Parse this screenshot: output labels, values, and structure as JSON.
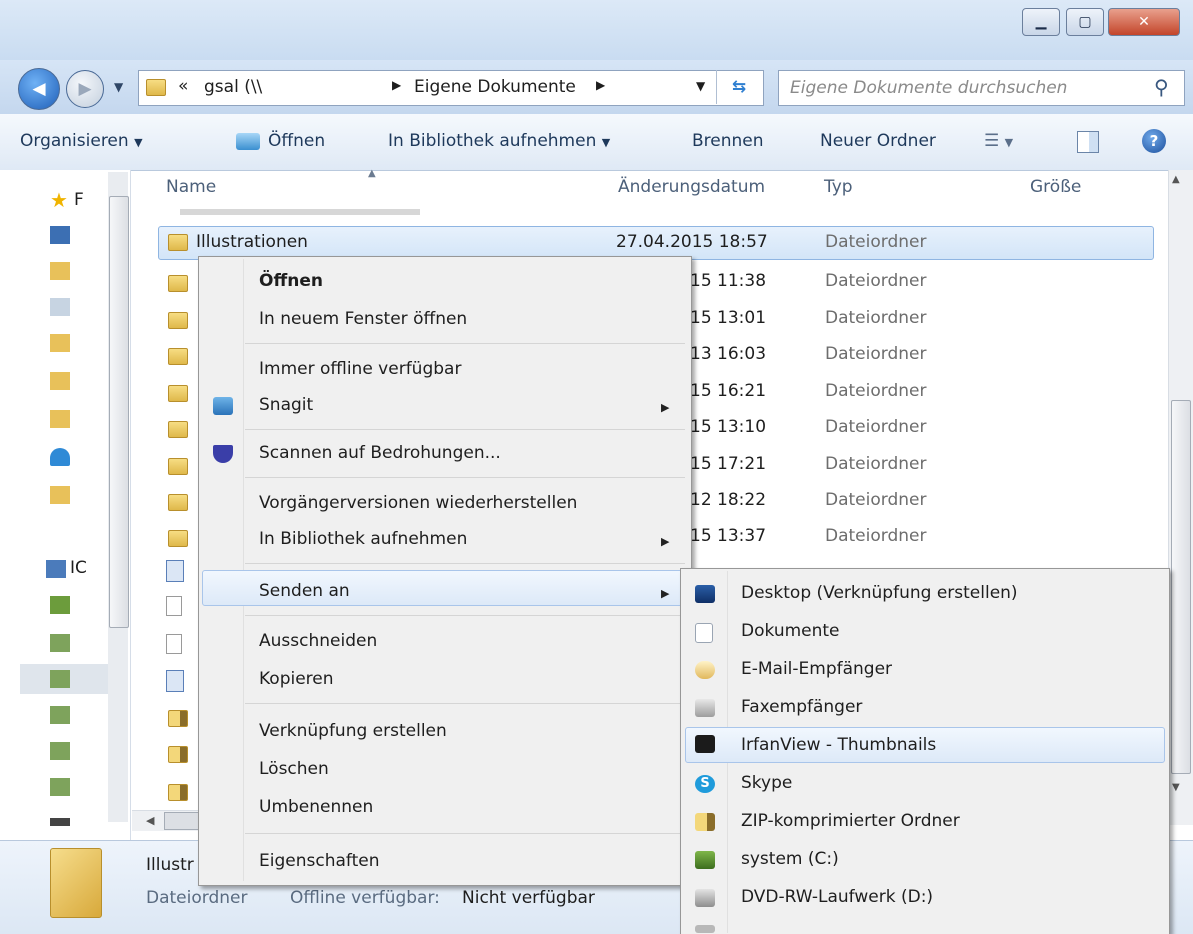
{
  "address": {
    "prefix": "«",
    "segment1": "gsal (\\\\",
    "segment2": "Eigene Dokumente",
    "search_placeholder": "Eigene Dokumente durchsuchen"
  },
  "toolbar": {
    "organize": "Organisieren",
    "open": "Öffnen",
    "add_library": "In Bibliothek aufnehmen",
    "burn": "Brennen",
    "new_folder": "Neuer Ordner"
  },
  "columns": {
    "name": "Name",
    "date": "Änderungsdatum",
    "type": "Typ",
    "size": "Größe"
  },
  "nav": {
    "favorites": "F",
    "computer": "IC"
  },
  "rows": [
    {
      "name": "Illustrationen",
      "date": "27.04.2015 18:57",
      "type": "Dateiordner"
    },
    {
      "date": "15 11:38",
      "type": "Dateiordner"
    },
    {
      "date": "15 13:01",
      "type": "Dateiordner"
    },
    {
      "date": "13 16:03",
      "type": "Dateiordner"
    },
    {
      "date": "15 16:21",
      "type": "Dateiordner"
    },
    {
      "date": "15 13:10",
      "type": "Dateiordner"
    },
    {
      "date": "15 17:21",
      "type": "Dateiordner"
    },
    {
      "date": "12 18:22",
      "type": "Dateiordner"
    },
    {
      "date": "15 13:37",
      "type": "Dateiordner"
    }
  ],
  "context_menu": {
    "open": "Öffnen",
    "open_new_window": "In neuem Fenster öffnen",
    "always_offline": "Immer offline verfügbar",
    "snagit": "Snagit",
    "scan": "Scannen auf Bedrohungen...",
    "restore_versions": "Vorgängerversionen wiederherstellen",
    "add_library": "In Bibliothek aufnehmen",
    "send_to": "Senden an",
    "cut": "Ausschneiden",
    "copy": "Kopieren",
    "create_shortcut": "Verknüpfung erstellen",
    "delete": "Löschen",
    "rename": "Umbenennen",
    "properties": "Eigenschaften"
  },
  "send_to_menu": [
    {
      "label": "Desktop (Verknüpfung erstellen)",
      "icon": "desktop-icon"
    },
    {
      "label": "Dokumente",
      "icon": "document-icon"
    },
    {
      "label": "E-Mail-Empfänger",
      "icon": "mail-icon"
    },
    {
      "label": "Faxempfänger",
      "icon": "fax-icon"
    },
    {
      "label": "IrfanView - Thumbnails",
      "icon": "irfanview-icon"
    },
    {
      "label": "Skype",
      "icon": "skype-icon"
    },
    {
      "label": "ZIP-komprimierter Ordner",
      "icon": "zip-folder-icon"
    },
    {
      "label": "system (C:)",
      "icon": "drive-icon"
    },
    {
      "label": "DVD-RW-Laufwerk (D:)",
      "icon": "dvd-drive-icon"
    }
  ],
  "details": {
    "name": "Illustr",
    "type": "Dateiordner",
    "offline_label": "Offline verfügbar:",
    "offline_value": "Nicht verfügbar"
  }
}
